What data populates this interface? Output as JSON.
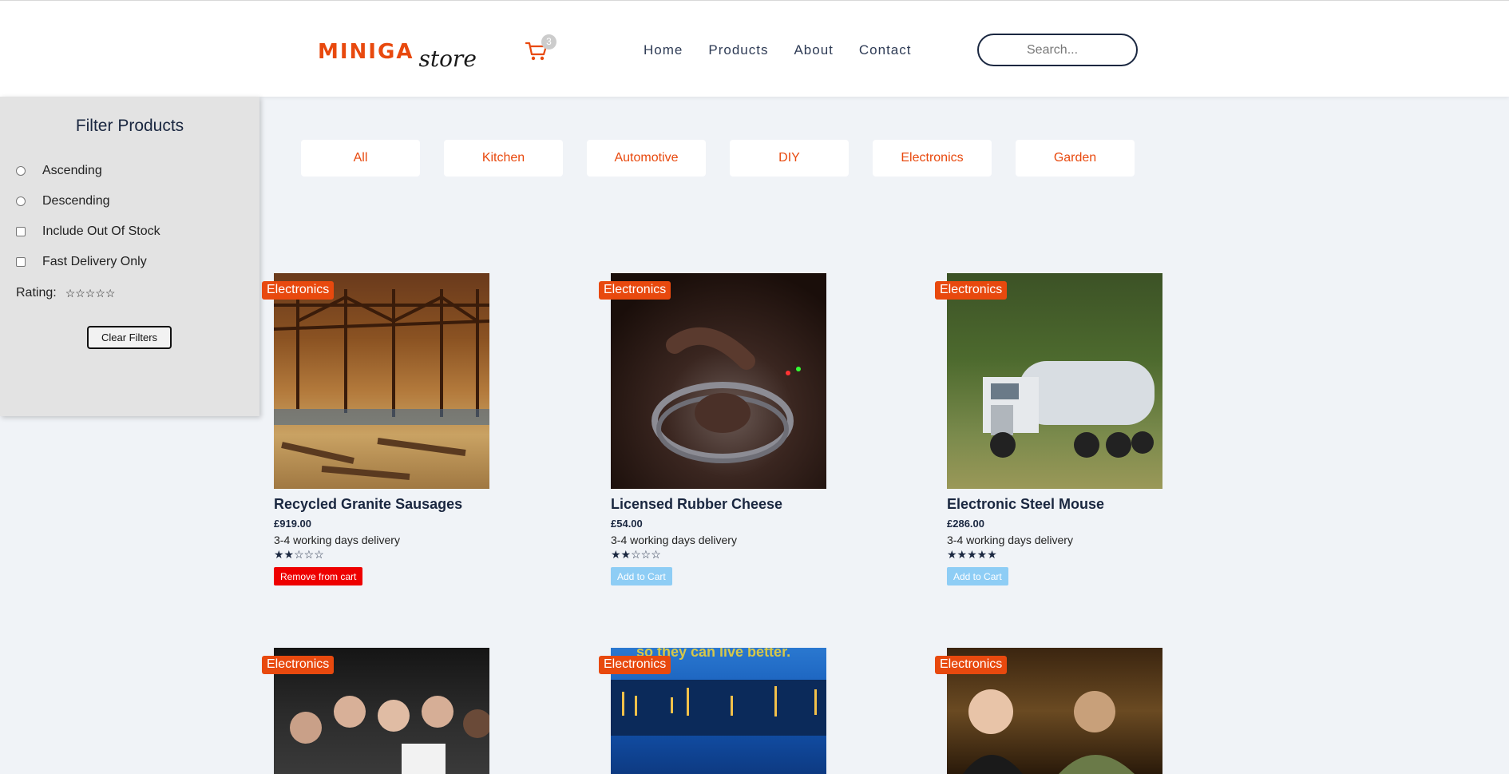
{
  "header": {
    "logo_main": "MINIGA",
    "logo_sub": "store",
    "cart_count": "3",
    "nav": [
      "Home",
      "Products",
      "About",
      "Contact"
    ],
    "search_placeholder": "Search..."
  },
  "sidebar": {
    "title": "Filter Products",
    "options": [
      "Ascending",
      "Descending",
      "Include Out Of Stock",
      "Fast Delivery Only"
    ],
    "rating_label": "Rating:",
    "rating_stars": "☆☆☆☆☆",
    "clear_label": "Clear Filters"
  },
  "categories": [
    "All",
    "Kitchen",
    "Automotive",
    "DIY",
    "Electronics",
    "Garden"
  ],
  "products": [
    {
      "category": "Electronics",
      "name": "Recycled Granite Sausages",
      "price": "£919.00",
      "delivery": "3-4 working days delivery",
      "rating": 2,
      "stars": "★★☆☆☆",
      "action": "Remove from cart"
    },
    {
      "category": "Electronics",
      "name": "Licensed Rubber Cheese",
      "price": "£54.00",
      "delivery": "3-4 working days delivery",
      "rating": 2,
      "stars": "★★☆☆☆",
      "action": "Add to Cart"
    },
    {
      "category": "Electronics",
      "name": "Electronic Steel Mouse",
      "price": "£286.00",
      "delivery": "3-4 working days delivery",
      "rating": 5,
      "stars": "★★★★★",
      "action": "Add to Cart"
    },
    {
      "category": "Electronics"
    },
    {
      "category": "Electronics",
      "image_text": "so they can live better."
    },
    {
      "category": "Electronics"
    }
  ],
  "colors": {
    "accent": "#e8490e",
    "remove": "#ee0000",
    "add": "#8ecdf5",
    "navy": "#1a2740"
  }
}
